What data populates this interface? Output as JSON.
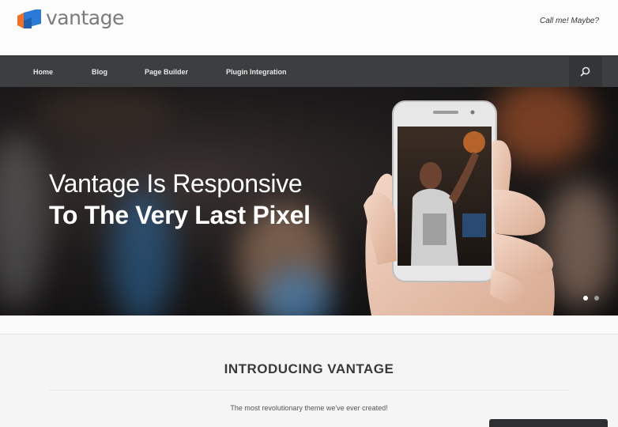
{
  "site": {
    "name": "vantage",
    "tagline": "Call me! Maybe?"
  },
  "nav": {
    "items": [
      "Home",
      "Blog",
      "Page Builder",
      "Plugin Integration"
    ]
  },
  "hero": {
    "line1": "Vantage Is Responsive",
    "line2": "To The Very Last Pixel",
    "active_slide": 1,
    "slide_count": 2
  },
  "intro": {
    "title": "INTRODUCING VANTAGE",
    "subtitle": "The most revolutionary theme we've ever created!"
  },
  "colors": {
    "logo_orange": "#f36f24",
    "logo_blue": "#2b7ad8",
    "nav_bg": "#3c3e40"
  }
}
